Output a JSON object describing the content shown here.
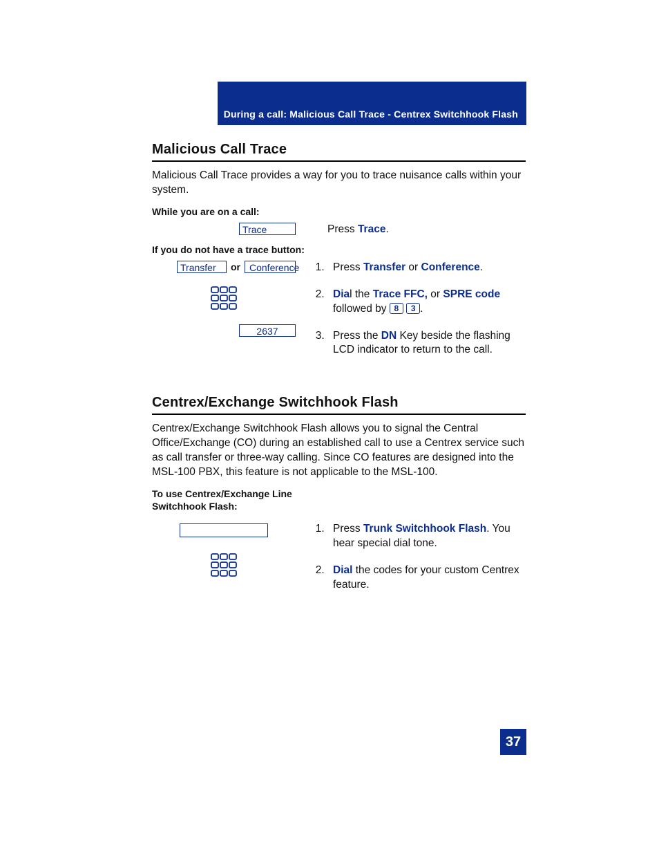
{
  "header": {
    "title": "During a call: Malicious Call Trace - Centrex Switchhook Flash"
  },
  "section1": {
    "title": "Malicious Call Trace",
    "intro": "Malicious Call Trace provides a way for you to trace nuisance calls within your system.",
    "sub1": "While you are on a call:",
    "trace_btn": "Trace",
    "press_word": "Press ",
    "trace_kw": "Trace",
    "period": ".",
    "sub2": "If you do not have a trace button:",
    "transfer_btn": "Transfer",
    "or_word": "or",
    "conference_btn": "Conference",
    "dn_display": "2637",
    "step1_a": "Press ",
    "step1_b": "Transfer",
    "step1_c": " or ",
    "step1_d": "Conference",
    "step1_e": ".",
    "step2_a": "Dia",
    "step2_a2": "l the ",
    "step2_b": "Trace FFC,",
    "step2_c": " or ",
    "step2_d": "SPRE code",
    "step2_e": " followed by ",
    "step2_key1": "8",
    "step2_key2": "3",
    "step2_f": ".",
    "step3_a": "Press the ",
    "step3_b": "DN",
    "step3_c": " Key beside the flashing LCD indicator to return to the call."
  },
  "section2": {
    "title": "Centrex/Exchange Switchhook Flash",
    "intro": "Centrex/Exchange Switchhook Flash allows you to signal the Central Office/Exchange (CO) during an established call to use a Centrex service such as call transfer or three-way calling. Since CO features are designed into the MSL-100 PBX, this feature is not applicable to the MSL-100.",
    "sub1a": "To use Centrex/Exchange Line",
    "sub1b": "Switchhook Flash:",
    "step1_a": "Press ",
    "step1_b": "Trunk Switchhook Flash",
    "step1_c": ". You hear special dial tone.",
    "step2_a": "Dial",
    "step2_b": " the codes for your custom Centrex feature."
  },
  "page_number": "37"
}
